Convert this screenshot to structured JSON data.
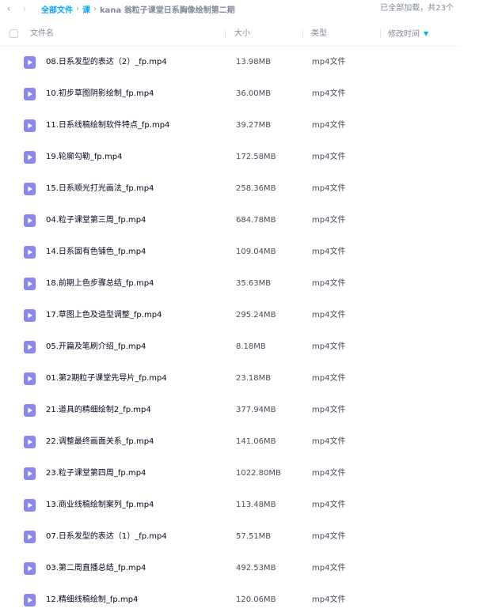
{
  "breadcrumb": {
    "root": "全部文件",
    "level1": "课",
    "current": "kana 翁粒子课堂日系胸像绘制第二期"
  },
  "status_text": "已全部加载，共23个",
  "columns": {
    "name": "文件名",
    "size": "大小",
    "type": "类型",
    "modified": "修改时间"
  },
  "colors": {
    "accent": "#06a7ff",
    "video_icon": "#8a88f0"
  },
  "files": [
    {
      "name": "08.日系发型的表达（2）_fp.mp4",
      "size": "13.98MB",
      "type": "mp4文件"
    },
    {
      "name": "10.初步草图阴影绘制_fp.mp4",
      "size": "36.00MB",
      "type": "mp4文件"
    },
    {
      "name": "11.日系线稿绘制软件特点_fp.mp4",
      "size": "39.27MB",
      "type": "mp4文件"
    },
    {
      "name": "19.轮廓勾勒_fp.mp4",
      "size": "172.58MB",
      "type": "mp4文件"
    },
    {
      "name": "15.日系顺光打光画法_fp.mp4",
      "size": "258.36MB",
      "type": "mp4文件"
    },
    {
      "name": "04.粒子课堂第三周_fp.mp4",
      "size": "684.78MB",
      "type": "mp4文件"
    },
    {
      "name": "14.日系固有色铺色_fp.mp4",
      "size": "109.04MB",
      "type": "mp4文件"
    },
    {
      "name": "18.前期上色步骤总结_fp.mp4",
      "size": "35.63MB",
      "type": "mp4文件"
    },
    {
      "name": "17.草图上色及造型调整_fp.mp4",
      "size": "295.24MB",
      "type": "mp4文件"
    },
    {
      "name": "05.开篇及笔刷介绍_fp.mp4",
      "size": "8.18MB",
      "type": "mp4文件"
    },
    {
      "name": "01.第2期粒子课堂先导片_fp.mp4",
      "size": "23.18MB",
      "type": "mp4文件"
    },
    {
      "name": "21.道具的精细绘制2_fp.mp4",
      "size": "377.94MB",
      "type": "mp4文件"
    },
    {
      "name": "22.调整最终画面关系_fp.mp4",
      "size": "141.06MB",
      "type": "mp4文件"
    },
    {
      "name": "23.粒子课堂第四周_fp.mp4",
      "size": "1022.80MB",
      "type": "mp4文件"
    },
    {
      "name": "13.商业线稿绘制案列_fp.mp4",
      "size": "113.48MB",
      "type": "mp4文件"
    },
    {
      "name": "07.日系发型的表达（1）_fp.mp4",
      "size": "57.51MB",
      "type": "mp4文件"
    },
    {
      "name": "03.第二周直播总结_fp.mp4",
      "size": "492.53MB",
      "type": "mp4文件"
    },
    {
      "name": "12.精细线稿绘制_fp.mp4",
      "size": "120.06MB",
      "type": "mp4文件"
    }
  ]
}
